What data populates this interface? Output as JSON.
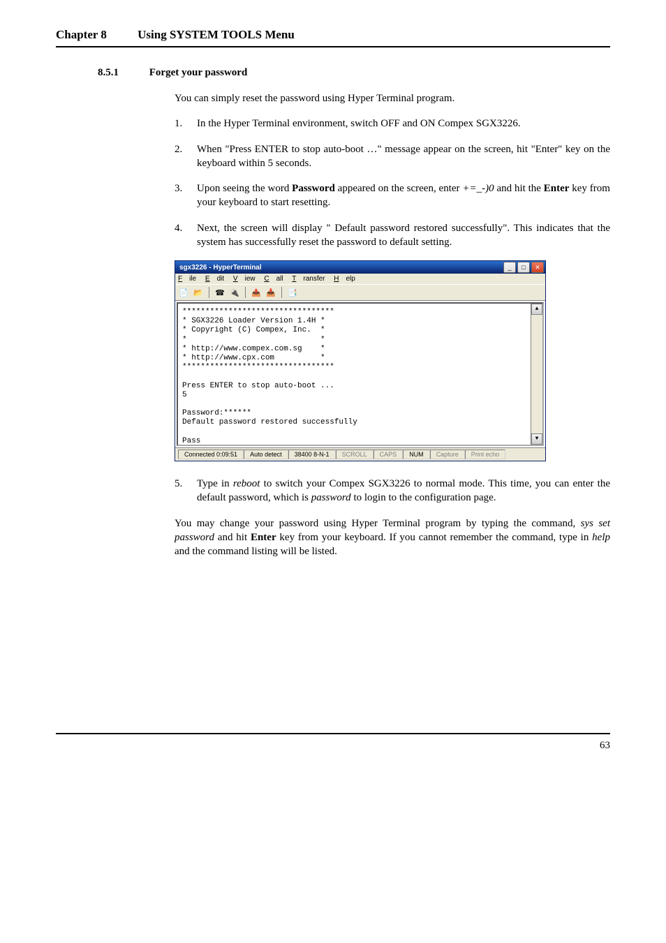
{
  "header": {
    "chapter": "Chapter 8",
    "title": "Using SYSTEM TOOLS Menu"
  },
  "section": {
    "number": "8.5.1",
    "title": "Forget your password"
  },
  "intro": "You can simply reset the password using Hyper Terminal program.",
  "steps_a": [
    {
      "n": "1.",
      "text": "In the Hyper Terminal environment, switch OFF and ON Compex SGX3226."
    },
    {
      "n": "2.",
      "text": "When \"Press ENTER to stop auto-boot …\" message appear on the screen, hit \"Enter\" key on the keyboard within 5 seconds."
    },
    {
      "n": "3.",
      "pre": "Upon seeing the word ",
      "bold1": "Password",
      "mid": " appeared on the screen, enter ",
      "italic1": "+=_-)0",
      "mid2": " and hit the ",
      "bold2": "Enter",
      "post": " key from your keyboard to start resetting."
    },
    {
      "n": "4.",
      "text": "Next, the screen will display \" Default password restored successfully\". This indicates that the system has successfully reset the password to default setting."
    }
  ],
  "terminal": {
    "title": "sgx3226 - HyperTerminal",
    "menu": {
      "file": "File",
      "edit": "Edit",
      "view": "View",
      "call": "Call",
      "transfer": "Transfer",
      "help": "Help"
    },
    "content": "*********************************\n* SGX3226 Loader Version 1.4H *\n* Copyright (C) Compex, Inc.  *\n*                             *\n* http://www.compex.com.sg    *\n* http://www.cpx.com          *\n*********************************\n\nPress ENTER to stop auto-boot ...\n5\n\nPassword:******\nDefault password restored successfully\n\nPass\n\n->reboot_",
    "status": {
      "connected": "Connected 0:09:51",
      "detect": "Auto detect",
      "baud": "38400 8-N-1",
      "scroll": "SCROLL",
      "caps": "CAPS",
      "num": "NUM",
      "capture": "Capture",
      "print": "Print echo"
    }
  },
  "steps_b": [
    {
      "n": "5.",
      "pre": "Type in ",
      "italic1": "reboot",
      "mid": " to switch your Compex SGX3226 to normal mode. This time, you can enter the default password, which is ",
      "italic2": "password",
      "post": " to login to the configuration page."
    }
  ],
  "closing": {
    "pre": "You may change your password using Hyper Terminal program by typing the command, ",
    "italic1": "sys set password",
    "mid": " and hit ",
    "bold1": "Enter",
    "mid2": " key from your keyboard. If you cannot remember the command, type in ",
    "italic2": "help",
    "post": " and the command listing will be listed."
  },
  "page_number": "63"
}
